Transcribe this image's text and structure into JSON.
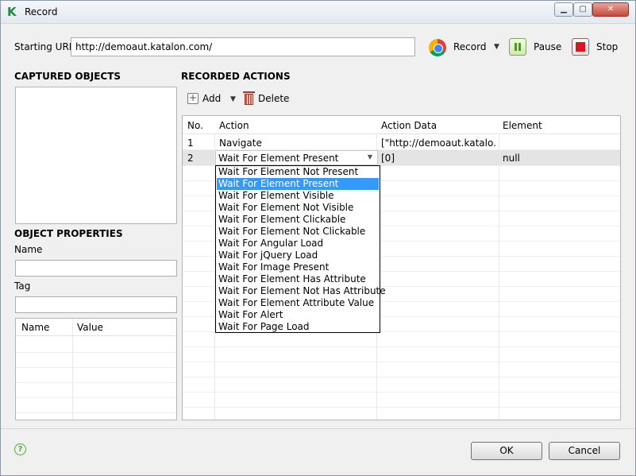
{
  "window": {
    "title": "Record"
  },
  "header": {
    "starting_url_label": "Starting URL",
    "starting_url_value": "http://demoaut.katalon.com/",
    "record_label": "Record",
    "pause_label": "Pause",
    "stop_label": "Stop"
  },
  "left": {
    "captured_objects_title": "CAPTURED OBJECTS",
    "object_properties_title": "OBJECT PROPERTIES",
    "name_label": "Name",
    "tag_label": "Tag",
    "table_headers": [
      "Name",
      "Value"
    ]
  },
  "right": {
    "recorded_actions_title": "RECORDED ACTIONS",
    "add_label": "Add",
    "delete_label": "Delete",
    "table_headers": [
      "No.",
      "Action",
      "Action Data",
      "Element"
    ],
    "rows": [
      {
        "no": "1",
        "action": "Navigate",
        "action_data": "[\"http://demoaut.katalo...",
        "element": ""
      },
      {
        "no": "2",
        "action": "Wait For Element Present",
        "action_data": "[0]",
        "element": "null"
      }
    ],
    "dropdown_options": [
      "Wait For Element Not Present",
      "Wait For Element Present",
      "Wait For Element Visible",
      "Wait For Element Not Visible",
      "Wait For Element Clickable",
      "Wait For Element Not Clickable",
      "Wait For Angular Load",
      "Wait For jQuery Load",
      "Wait For Image Present",
      "Wait For Element Has Attribute",
      "Wait For Element Not Has Attribute",
      "Wait For Element Attribute Value",
      "Wait For Alert",
      "Wait For Page Load"
    ],
    "dropdown_selected": "Wait For Element Present"
  },
  "footer": {
    "ok_label": "OK",
    "cancel_label": "Cancel",
    "help_icon": "?"
  },
  "colors": {
    "selection": "#3399ff",
    "stop": "#e0141c",
    "pause": "#4b9a1f",
    "help": "#5aa336"
  }
}
